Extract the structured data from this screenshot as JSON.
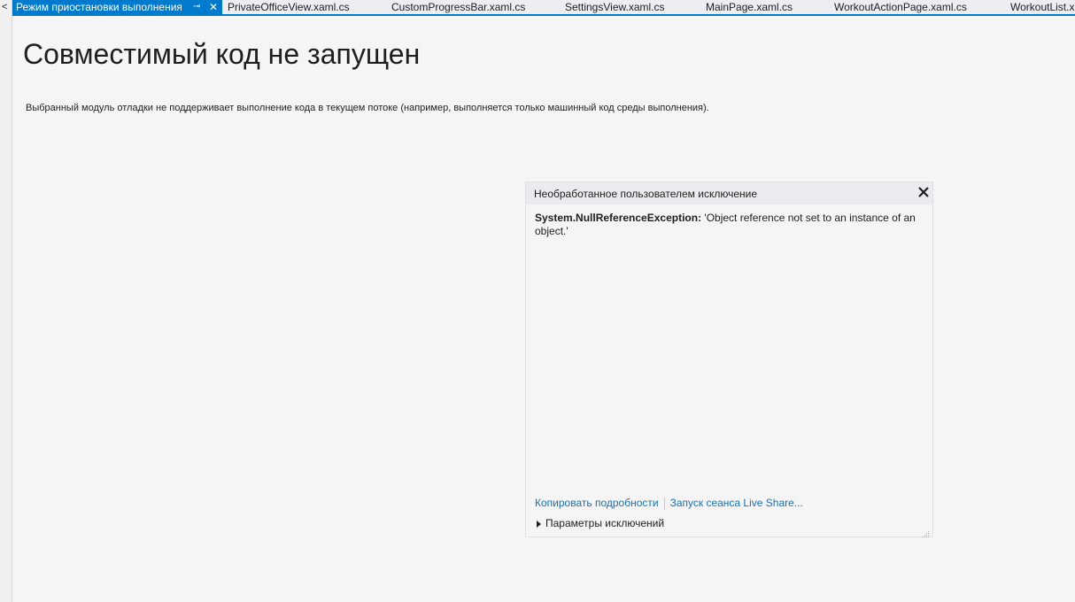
{
  "left_strip": {
    "arrow": "<"
  },
  "tabs": [
    {
      "label": "Режим приостановки выполнения",
      "active": true
    },
    {
      "label": "PrivateOfficeView.xaml.cs"
    },
    {
      "label": "CustomProgressBar.xaml.cs"
    },
    {
      "label": "SettingsView.xaml.cs"
    },
    {
      "label": "MainPage.xaml.cs"
    },
    {
      "label": "WorkoutActionPage.xaml.cs"
    },
    {
      "label": "WorkoutList.x"
    }
  ],
  "page": {
    "title": "Совместимый код не запущен",
    "description": "Выбранный модуль отладки не поддерживает выполнение кода в текущем потоке (например, выполняется только машинный код среды выполнения)."
  },
  "exception": {
    "header": "Необработанное пользователем исключение",
    "type": "System.NullReferenceException:",
    "message": " 'Object reference not set to an instance of an object.'",
    "copy_link": "Копировать подробности",
    "live_share_link": "Запуск сеанса Live Share...",
    "settings_label": "Параметры исключений"
  },
  "colors": {
    "accent": "#007acc",
    "link": "#1a6fb4",
    "background": "#f5f5f5"
  },
  "icons": {
    "pin": "pin-icon",
    "close": "close-icon",
    "expand": "triangle-right-icon",
    "resize": "resize-grip-icon"
  }
}
